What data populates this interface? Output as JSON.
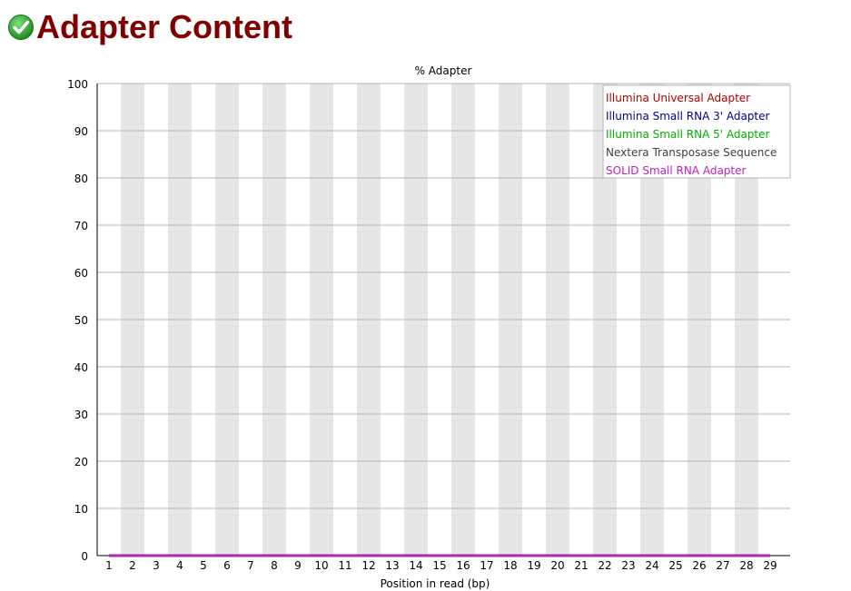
{
  "header": {
    "title": "Adapter Content",
    "status_icon": "pass-check-icon",
    "status_color": "#2e9e2e"
  },
  "chart_data": {
    "type": "line",
    "title": "% Adapter",
    "xlabel": "Position in read (bp)",
    "ylabel": "",
    "categories": [
      "1",
      "2",
      "3",
      "4",
      "5",
      "6",
      "7",
      "8",
      "9",
      "10",
      "11",
      "12",
      "13",
      "14",
      "15",
      "16",
      "17",
      "18",
      "19",
      "20",
      "21",
      "22",
      "23",
      "24",
      "25",
      "26",
      "27",
      "28",
      "29"
    ],
    "ylim": [
      0,
      100
    ],
    "yticks": [
      0,
      10,
      20,
      30,
      40,
      50,
      60,
      70,
      80,
      90,
      100
    ],
    "grid": true,
    "legend_position": "top-right",
    "series": [
      {
        "name": "Illumina Universal Adapter",
        "color": "#b00000",
        "values": [
          0,
          0,
          0,
          0,
          0,
          0,
          0,
          0,
          0,
          0,
          0,
          0,
          0,
          0,
          0,
          0,
          0,
          0,
          0,
          0,
          0,
          0,
          0,
          0,
          0,
          0,
          0,
          0,
          0
        ]
      },
      {
        "name": "Illumina Small RNA 3' Adapter",
        "color": "#000090",
        "values": [
          0,
          0,
          0,
          0,
          0,
          0,
          0,
          0,
          0,
          0,
          0,
          0,
          0,
          0,
          0,
          0,
          0,
          0,
          0,
          0,
          0,
          0,
          0,
          0,
          0,
          0,
          0,
          0,
          0
        ]
      },
      {
        "name": "Illumina Small RNA 5' Adapter",
        "color": "#00b000",
        "values": [
          0,
          0,
          0,
          0,
          0,
          0,
          0,
          0,
          0,
          0,
          0,
          0,
          0,
          0,
          0,
          0,
          0,
          0,
          0,
          0,
          0,
          0,
          0,
          0,
          0,
          0,
          0,
          0,
          0
        ]
      },
      {
        "name": "Nextera Transposase Sequence",
        "color": "#404040",
        "values": [
          0,
          0,
          0,
          0,
          0,
          0,
          0,
          0,
          0,
          0,
          0,
          0,
          0,
          0,
          0,
          0,
          0,
          0,
          0,
          0,
          0,
          0,
          0,
          0,
          0,
          0,
          0,
          0,
          0
        ]
      },
      {
        "name": "SOLID Small RNA Adapter",
        "color": "#c020c0",
        "values": [
          0,
          0,
          0,
          0,
          0,
          0,
          0,
          0,
          0,
          0,
          0,
          0,
          0,
          0,
          0,
          0,
          0,
          0,
          0,
          0,
          0,
          0,
          0,
          0,
          0,
          0,
          0,
          0,
          0
        ]
      }
    ]
  }
}
